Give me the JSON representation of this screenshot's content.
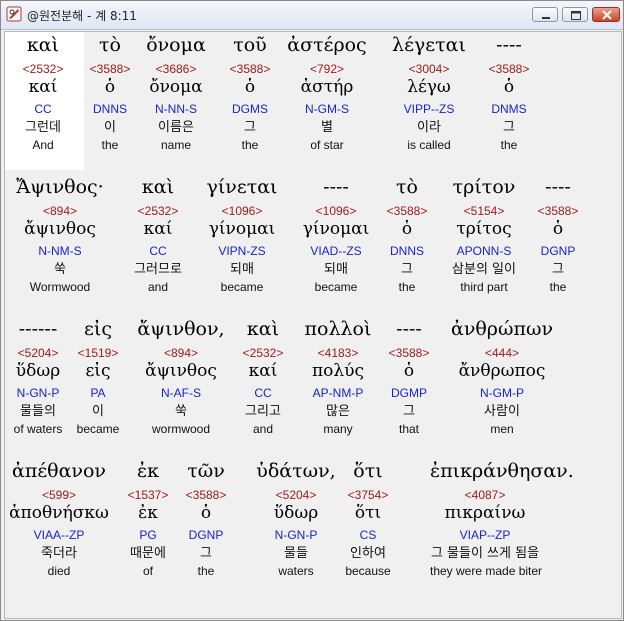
{
  "window": {
    "title": "@원전분해 - 계 8:11",
    "icon": "app-logo-icon",
    "buttons": [
      "minimize-icon",
      "maximize-icon",
      "close-icon"
    ]
  },
  "colors": {
    "strong": "#a01a1a",
    "parse": "#1a23c8",
    "text": "#000000"
  },
  "rows": [
    {
      "words": [
        {
          "greek": "καὶ",
          "strong": "<2532>",
          "lemma": "καί",
          "parse": "CC",
          "korean": "그런데",
          "english": "And"
        },
        {
          "greek": "τὸ",
          "strong": "<3588>",
          "lemma": "ὁ",
          "parse": "DNNS",
          "korean": "이",
          "english": "the"
        },
        {
          "greek": "ὄνομα",
          "strong": "<3686>",
          "lemma": "ὄνομα",
          "parse": "N-NN-S",
          "korean": "이름은",
          "english": "name"
        },
        {
          "greek": "τοῦ",
          "strong": "<3588>",
          "lemma": "ὁ",
          "parse": "DGMS",
          "korean": "그",
          "english": "the"
        },
        {
          "greek": "ἀστέρος",
          "strong": "<792>",
          "lemma": "ἀστήρ",
          "parse": "N-GM-S",
          "korean": "별",
          "english": "of star"
        },
        {
          "greek": "λέγεται",
          "strong": "<3004>",
          "lemma": "λέγω",
          "parse": "VIPP--ZS",
          "korean": "이라",
          "english": "is called"
        },
        {
          "greek": "----",
          "strong": "<3588>",
          "lemma": "ὁ",
          "parse": "DNMS",
          "korean": "그",
          "english": "the"
        }
      ]
    },
    {
      "words": [
        {
          "greek": "Ἄψινθος·",
          "strong": "<894>",
          "lemma": "ἄψινθος",
          "parse": "N-NM-S",
          "korean": "쑥",
          "english": "Wormwood"
        },
        {
          "greek": "καὶ",
          "strong": "<2532>",
          "lemma": "καί",
          "parse": "CC",
          "korean": "그러므로",
          "english": "and"
        },
        {
          "greek": "γίνεται",
          "strong": "<1096>",
          "lemma": "γίνομαι",
          "parse": "VIPN-ZS",
          "korean": "되매",
          "english": "became"
        },
        {
          "greek": "----",
          "strong": "<1096>",
          "lemma": "γίνομαι",
          "parse": "VIAD--ZS",
          "korean": "되매",
          "english": "became"
        },
        {
          "greek": "τὸ",
          "strong": "<3588>",
          "lemma": "ὁ",
          "parse": "DNNS",
          "korean": "그",
          "english": "the"
        },
        {
          "greek": "τρίτον",
          "strong": "<5154>",
          "lemma": "τρίτος",
          "parse": "APONN-S",
          "korean": "삼분의 일이",
          "english": "third part"
        },
        {
          "greek": "----",
          "strong": "<3588>",
          "lemma": "ὁ",
          "parse": "DGNP",
          "korean": "그",
          "english": "the"
        }
      ]
    },
    {
      "words": [
        {
          "greek": "------",
          "strong": "<5204>",
          "lemma": "ὕδωρ",
          "parse": "N-GN-P",
          "korean": "물들의",
          "english": "of waters"
        },
        {
          "greek": "εἰς",
          "strong": "<1519>",
          "lemma": "εἰς",
          "parse": "PA",
          "korean": "이",
          "english": "became"
        },
        {
          "greek": "ἄψινθον,",
          "strong": "<894>",
          "lemma": "ἄψινθος",
          "parse": "N-AF-S",
          "korean": "쑥",
          "english": "wormwood"
        },
        {
          "greek": "καὶ",
          "strong": "<2532>",
          "lemma": "καί",
          "parse": "CC",
          "korean": "그리고",
          "english": "and"
        },
        {
          "greek": "πολλοὶ",
          "strong": "<4183>",
          "lemma": "πολύς",
          "parse": "AP-NM-P",
          "korean": "많은",
          "english": "many"
        },
        {
          "greek": "----",
          "strong": "<3588>",
          "lemma": "ὁ",
          "parse": "DGMP",
          "korean": "그",
          "english": "that"
        },
        {
          "greek": "ἀνθρώπων",
          "strong": "<444>",
          "lemma": "ἄνθρωπος",
          "parse": "N-GM-P",
          "korean": "사람이",
          "english": "men"
        }
      ]
    },
    {
      "words": [
        {
          "greek": "ἀπέθανον",
          "strong": "<599>",
          "lemma": "ἀποθνήσκω",
          "parse": "VIAA--ZP",
          "korean": "죽더라",
          "english": "died"
        },
        {
          "greek": "ἐκ",
          "strong": "<1537>",
          "lemma": "ἐκ",
          "parse": "PG",
          "korean": "때문에",
          "english": "of"
        },
        {
          "greek": "τῶν",
          "strong": "<3588>",
          "lemma": "ὁ",
          "parse": "DGNP",
          "korean": "그",
          "english": "the"
        },
        {
          "greek": "ὑδάτων,",
          "strong": "<5204>",
          "lemma": "ὕδωρ",
          "parse": "N-GN-P",
          "korean": "물들",
          "english": "waters"
        },
        {
          "greek": "ὅτι",
          "strong": "<3754>",
          "lemma": "ὅτι",
          "parse": "CS",
          "korean": "인하여",
          "english": "because"
        },
        {
          "greek": "ἐπικράνθησαν.",
          "strong": "<4087>",
          "lemma": "πικραίνω",
          "parse": "VIAP--ZP",
          "korean": "그 물들이 쓰게 됨을",
          "english": "they were made biter"
        }
      ]
    }
  ]
}
